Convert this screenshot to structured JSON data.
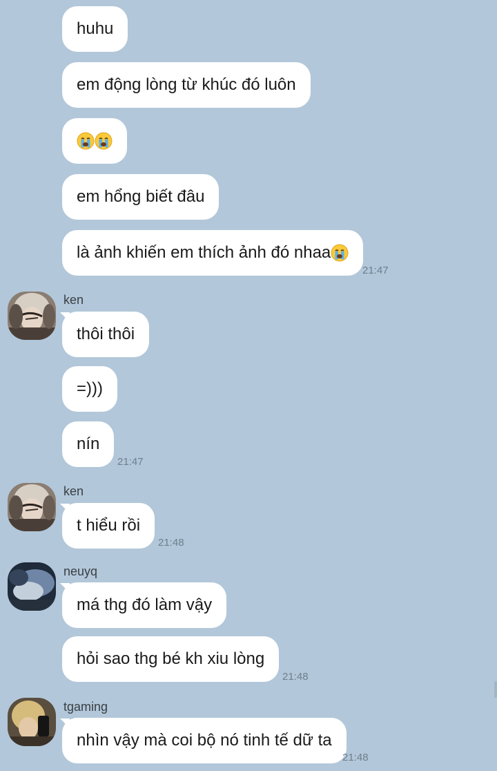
{
  "chat": {
    "messages": [
      {
        "text": "huhu"
      },
      {
        "text": "em động lòng từ khúc đó luôn"
      },
      {
        "text": "",
        "emoji": [
          "crying-face",
          "crying-face"
        ]
      },
      {
        "text": "em hổng biết đâu"
      },
      {
        "text": "là ảnh khiến em thích ảnh đó nhaa",
        "emoji": [
          "crying-face"
        ],
        "time": "21:47"
      },
      {
        "sender": "ken",
        "text": "thôi thôi"
      },
      {
        "text": "=)))"
      },
      {
        "text": "nín",
        "time": "21:47"
      },
      {
        "sender": "ken",
        "text": "t hiểu rồi",
        "time": "21:48"
      },
      {
        "sender": "neuyq",
        "text": "má thg đó làm vậy"
      },
      {
        "text": "hỏi sao thg bé kh xiu lòng",
        "time": "21:48"
      },
      {
        "sender": "tgaming",
        "text": "nhìn vậy mà coi bộ nó tinh tế dữ ta",
        "time": "21:48"
      }
    ]
  },
  "colors": {
    "background": "#b2c7d9",
    "bubble": "#ffffff",
    "timestamp": "#6d7f8c"
  }
}
